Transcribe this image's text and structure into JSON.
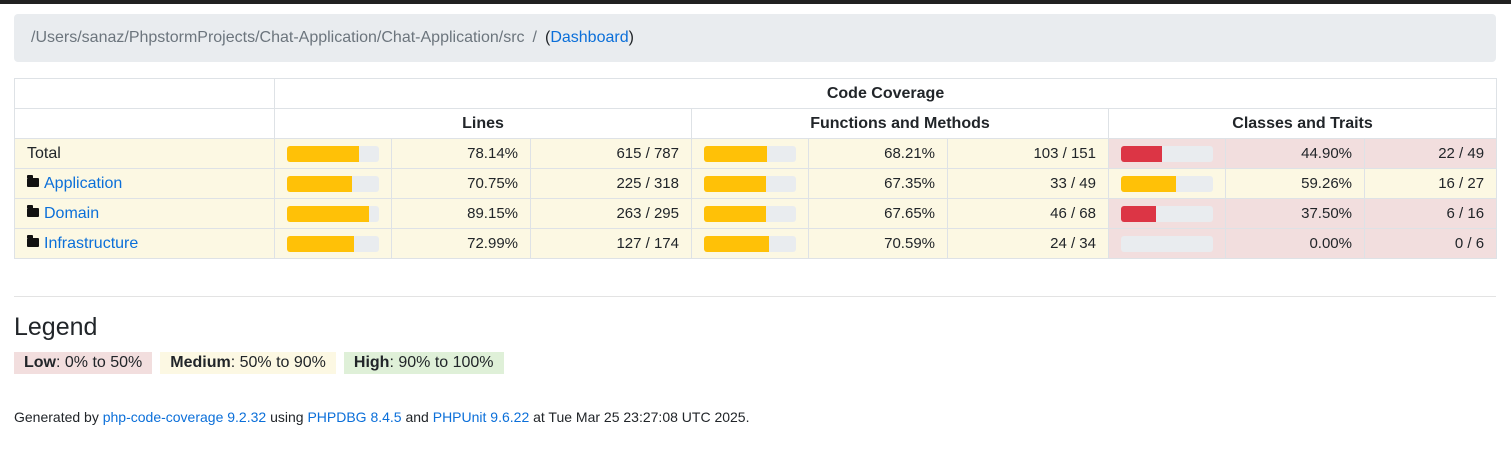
{
  "breadcrumb": {
    "path": "/Users/sanaz/PhpstormProjects/Chat-Application/Chat-Application/src",
    "separator": "/",
    "open_paren": "(",
    "link": "Dashboard",
    "close_paren": ")"
  },
  "table": {
    "group_header": "Code Coverage",
    "columns": [
      "Lines",
      "Functions and Methods",
      "Classes and Traits"
    ],
    "rows": [
      {
        "name": "Total",
        "is_folder": false,
        "lines": {
          "percent": "78.14%",
          "ratio": "615 / 787",
          "level": "medium",
          "fill": 78.14
        },
        "functions": {
          "percent": "68.21%",
          "ratio": "103 / 151",
          "level": "medium",
          "fill": 68.21
        },
        "classes": {
          "percent": "44.90%",
          "ratio": "22 / 49",
          "level": "low",
          "fill": 44.9
        }
      },
      {
        "name": "Application",
        "is_folder": true,
        "lines": {
          "percent": "70.75%",
          "ratio": "225 / 318",
          "level": "medium",
          "fill": 70.75
        },
        "functions": {
          "percent": "67.35%",
          "ratio": "33 / 49",
          "level": "medium",
          "fill": 67.35
        },
        "classes": {
          "percent": "59.26%",
          "ratio": "16 / 27",
          "level": "medium",
          "fill": 59.26
        }
      },
      {
        "name": "Domain",
        "is_folder": true,
        "lines": {
          "percent": "89.15%",
          "ratio": "263 / 295",
          "level": "medium",
          "fill": 89.15
        },
        "functions": {
          "percent": "67.65%",
          "ratio": "46 / 68",
          "level": "medium",
          "fill": 67.65
        },
        "classes": {
          "percent": "37.50%",
          "ratio": "6 / 16",
          "level": "low",
          "fill": 37.5
        }
      },
      {
        "name": "Infrastructure",
        "is_folder": true,
        "lines": {
          "percent": "72.99%",
          "ratio": "127 / 174",
          "level": "medium",
          "fill": 72.99
        },
        "functions": {
          "percent": "70.59%",
          "ratio": "24 / 34",
          "level": "medium",
          "fill": 70.59
        },
        "classes": {
          "percent": "0.00%",
          "ratio": "0 / 6",
          "level": "low",
          "fill": 0
        }
      }
    ]
  },
  "legend": {
    "title": "Legend",
    "low_label": "Low",
    "low_range": ": 0% to 50%",
    "medium_label": "Medium",
    "medium_range": ": 50% to 90%",
    "high_label": "High",
    "high_range": ": 90% to 100%"
  },
  "footer": {
    "prefix": "Generated by ",
    "tool": "php-code-coverage 9.2.32",
    "using": " using ",
    "runtime": "PHPDBG 8.4.5",
    "and": " and ",
    "framework": "PHPUnit 9.6.22",
    "suffix": " at Tue Mar 25 23:27:08 UTC 2025."
  },
  "colors": {
    "low_bg": "#f2dede",
    "medium_bg": "#fcf8e3",
    "high_bg": "#dff0d8",
    "bar_warning": "#ffc107",
    "bar_danger": "#dc3545",
    "link": "#0b6fd9"
  },
  "icons": {
    "folder": "folder-icon"
  }
}
